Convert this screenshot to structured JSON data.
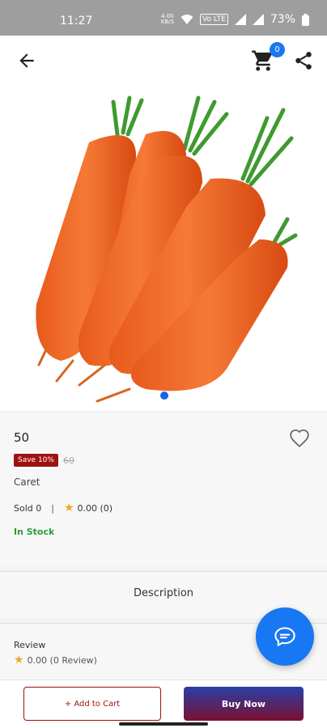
{
  "status_bar": {
    "time": "11:27",
    "data_speed_top": "4.00",
    "data_speed_unit": "KB/S",
    "lte_label": "Vo LTE",
    "battery": "73%"
  },
  "app_bar": {
    "back_icon": "arrow-left-icon",
    "cart_icon": "shopping-cart-icon",
    "cart_count": "0",
    "share_icon": "share-icon"
  },
  "product": {
    "image_alt": "carrots",
    "carousel_count": 1,
    "carousel_active": 0,
    "price": "50",
    "save_label": "Save 10%",
    "old_price": "60",
    "name": "Caret",
    "sold": "Sold 0",
    "rating": "0.00 (0)",
    "stock": "In Stock"
  },
  "tabs": {
    "description": "Description"
  },
  "review": {
    "title": "Review",
    "summary": "0.00 (0 Review)"
  },
  "actions": {
    "add_to_cart": "+ Add to Cart",
    "buy_now": "Buy Now"
  },
  "colors": {
    "accent_blue": "#1877f2",
    "save_red": "#9d1111",
    "stock_green": "#2e9b3a"
  }
}
